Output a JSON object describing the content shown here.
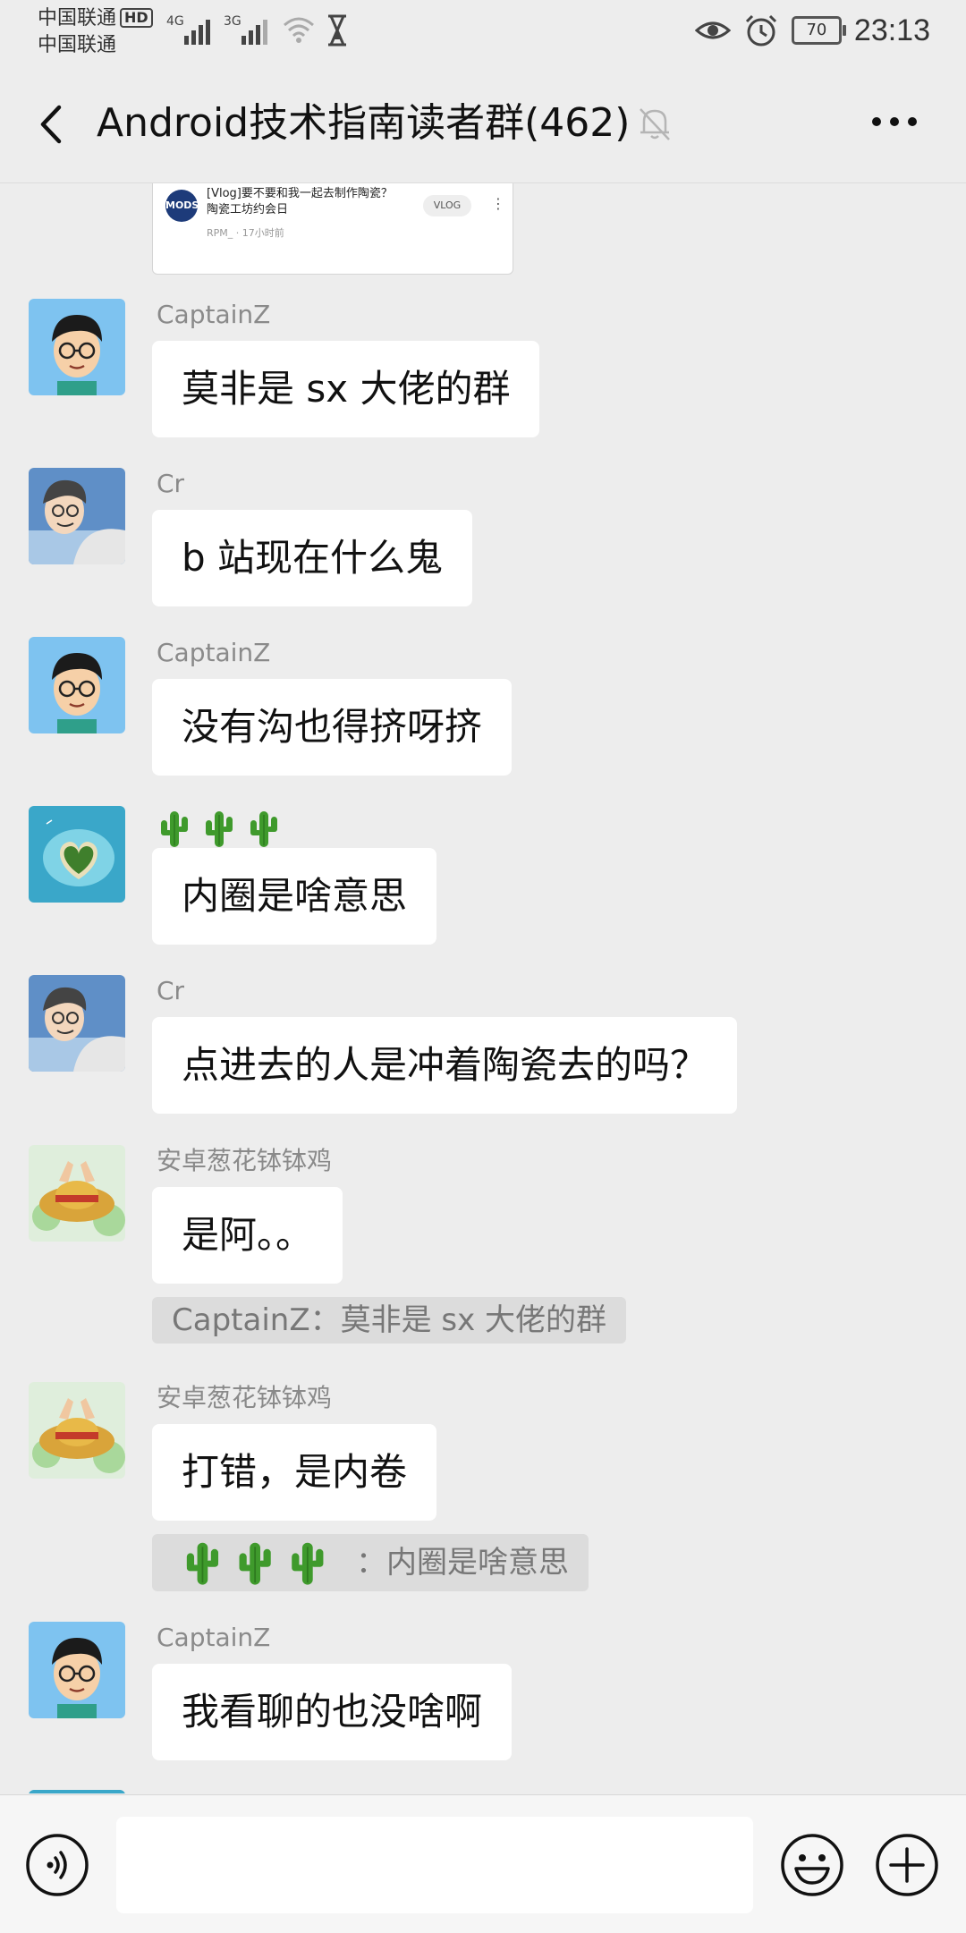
{
  "status_bar": {
    "carrier_1": "中国联通",
    "hd_badge": "HD",
    "carrier_2": "中国联通",
    "net_4g": "4G",
    "net_3g": "3G",
    "battery": "70",
    "time": "23:13"
  },
  "header": {
    "title": "Android技术指南读者群(462)"
  },
  "link_card": {
    "logo": "MODS",
    "title": "[Vlog]要不要和我一起去制作陶瓷？陶瓷工坊约会日",
    "badge": "VLOG",
    "meta": "RPM_ · 17小时前"
  },
  "messages": [
    {
      "sender": "CaptainZ",
      "text": "莫非是 sx 大佬的群"
    },
    {
      "sender": "Cr",
      "text": "b 站现在什么鬼"
    },
    {
      "sender": "CaptainZ",
      "text": "没有沟也得挤呀挤"
    },
    {
      "sender": "🌵🌵🌵",
      "text": "内圈是啥意思"
    },
    {
      "sender": "Cr",
      "text": "点进去的人是冲着陶瓷去的吗？"
    },
    {
      "sender": "安卓葱花钵钵鸡",
      "text": "是阿。。",
      "quote": "CaptainZ：莫非是 sx 大佬的群"
    },
    {
      "sender": "安卓葱花钵钵鸡",
      "text": "打错，是内卷",
      "quote": "：内圈是啥意思"
    },
    {
      "sender": "CaptainZ",
      "text": "我看聊的也没啥啊"
    }
  ],
  "input": {
    "value": "",
    "placeholder": ""
  },
  "icons": {
    "back": "back-arrow-icon",
    "mute": "bell-muted-icon",
    "more": "more-dots-icon",
    "voice": "voice-icon",
    "emoji": "emoji-icon",
    "plus": "plus-icon"
  },
  "colors": {
    "background": "#ededed",
    "bubble": "#ffffff",
    "sender": "#8a8a8a",
    "quote_bg": "#dcdcdc"
  }
}
